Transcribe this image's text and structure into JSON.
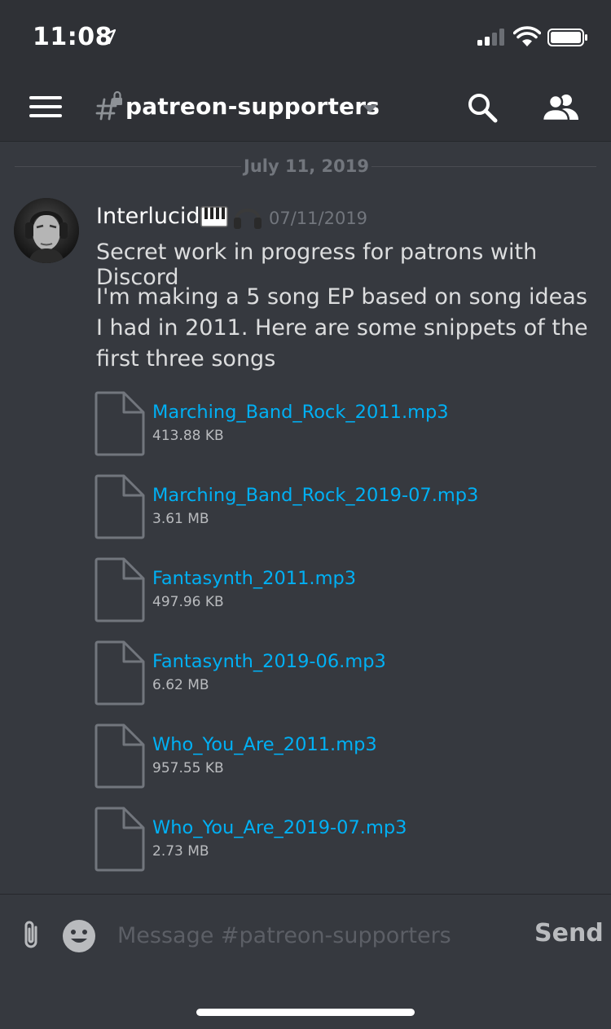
{
  "status_bar": {
    "time": "11:08",
    "icons": [
      "location-arrow-icon",
      "signal-icon",
      "wifi-icon",
      "battery-icon"
    ]
  },
  "header": {
    "channel_name": "patreon-supporters",
    "icons": [
      "menu-icon",
      "locked-hash-icon",
      "chevron-down-icon",
      "search-icon",
      "members-icon"
    ]
  },
  "divider": {
    "date": "July 11, 2019"
  },
  "message": {
    "author": "Interlucid",
    "author_emojis": [
      "piano-emoji",
      "headphones-emoji"
    ],
    "timestamp": "07/11/2019",
    "line1": "Secret work in progress for patrons with Discord",
    "body": "I'm making a 5 song EP based on song ideas I had in 2011.  Here are some snippets of the first three songs",
    "attachments": [
      {
        "name": "Marching_Band_Rock_2011.mp3",
        "size": "413.88 KB"
      },
      {
        "name": "Marching_Band_Rock_2019-07.mp3",
        "size": "3.61 MB"
      },
      {
        "name": "Fantasynth_2011.mp3",
        "size": "497.96 KB"
      },
      {
        "name": "Fantasynth_2019-06.mp3",
        "size": "6.62 MB"
      },
      {
        "name": "Who_You_Are_2011.mp3",
        "size": "957.55 KB"
      },
      {
        "name": "Who_You_Are_2019-07.mp3",
        "size": "2.73 MB"
      }
    ]
  },
  "composer": {
    "placeholder": "Message #patreon-supporters",
    "send_label": "Send"
  },
  "colors": {
    "background": "#36393f",
    "header": "#2f3136",
    "link": "#00b0f4",
    "muted": "#72767d",
    "text": "#dcddde"
  }
}
